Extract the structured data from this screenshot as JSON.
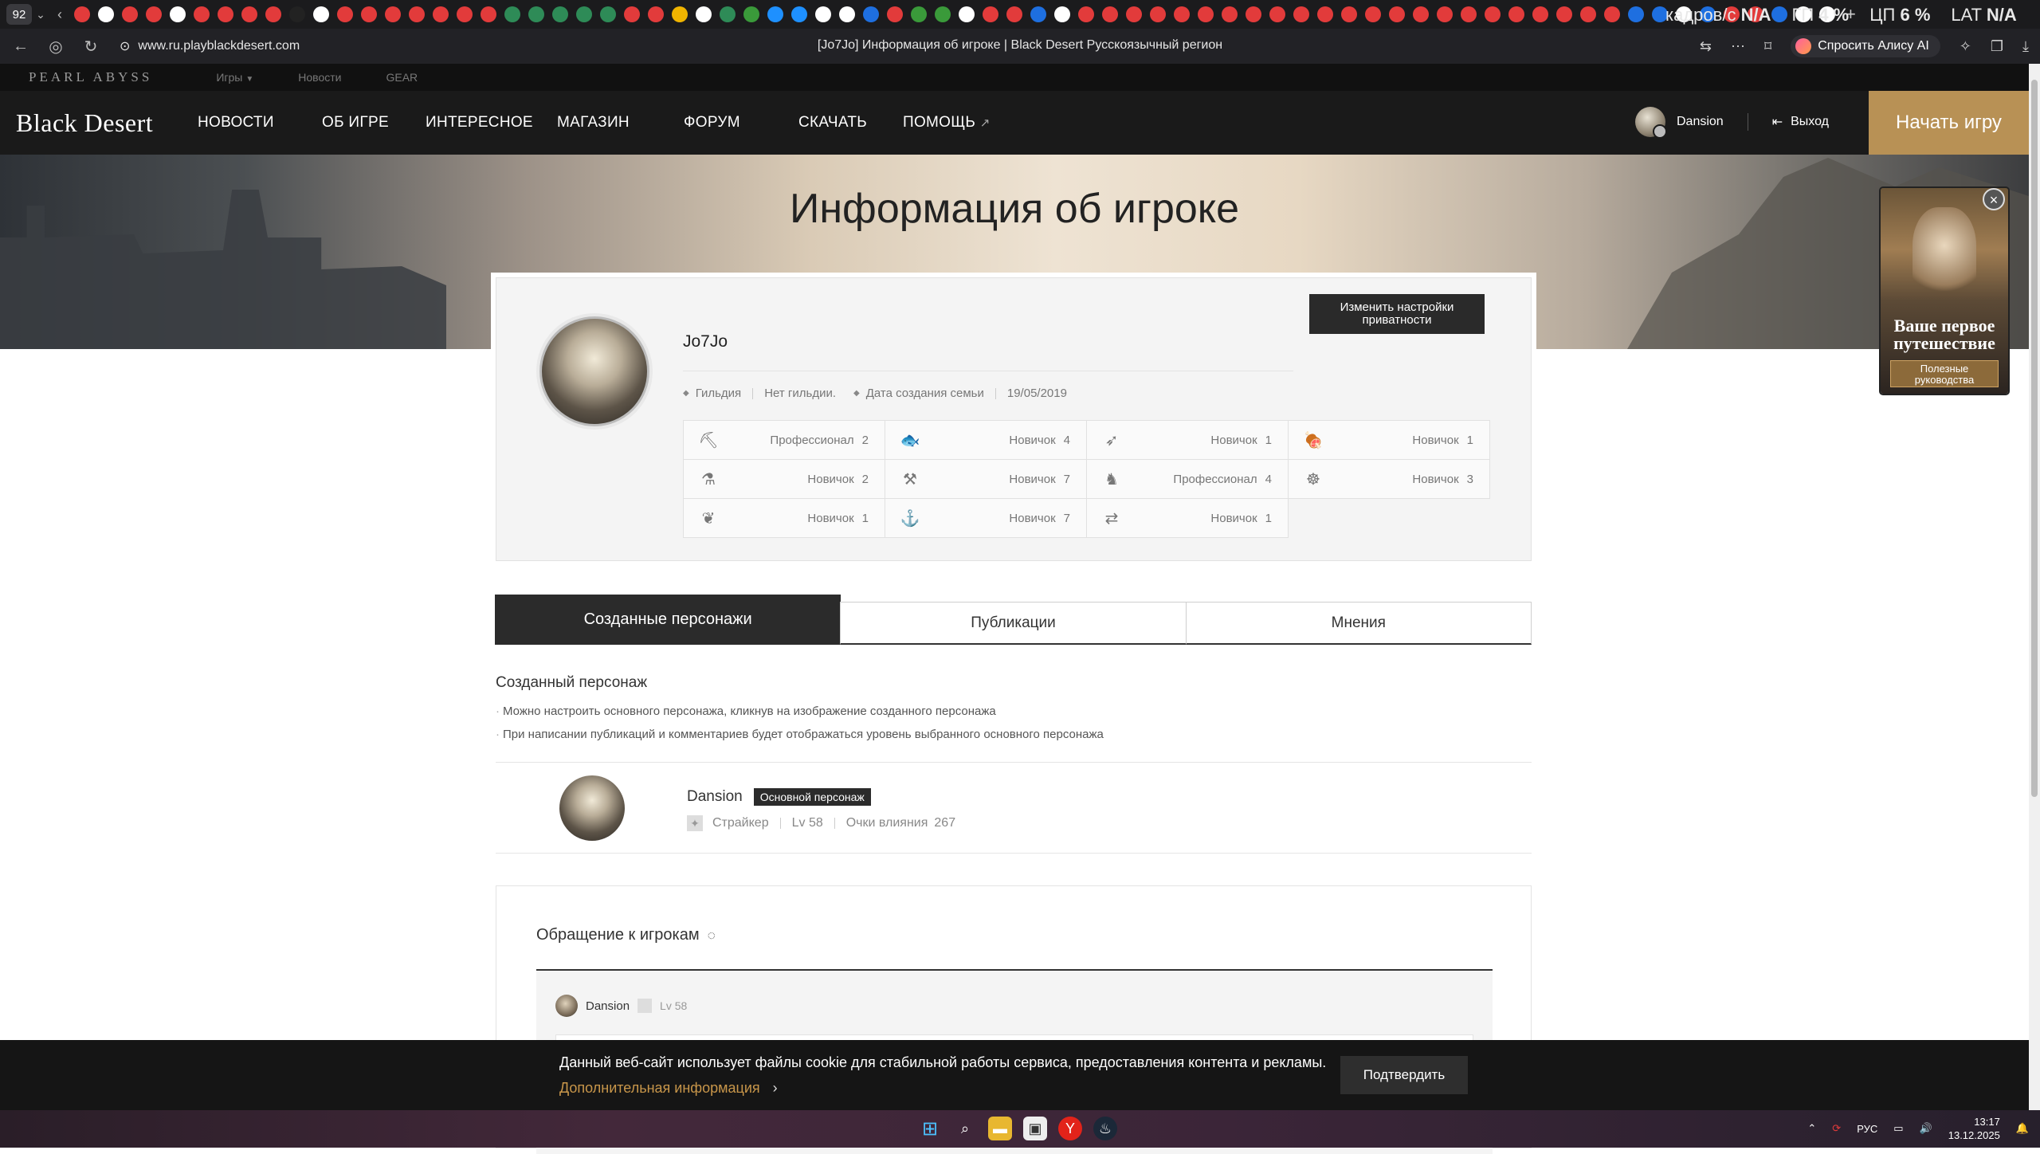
{
  "browser": {
    "tab_count": "92",
    "url": "www.ru.playblackdesert.com",
    "page_title": "[Jo7Jo] Информация об игроке | Black Desert Русскоязычный регион",
    "alice_label": "Спросить Алису AI",
    "overlay": {
      "fps_label": "кадров/с",
      "fps_value": "N/A",
      "gpu_label": "ГП",
      "gpu_value": "4 %",
      "cpu_label": "ЦП",
      "cpu_value": "6 %",
      "lat_label": "LAT",
      "lat_value": "N/A"
    },
    "tab_icon_colors": [
      "#e23b3b",
      "#ffffff",
      "#e23b3b",
      "#e23b3b",
      "#ffffff",
      "#e23b3b",
      "#e23b3b",
      "#e23b3b",
      "#e23b3b",
      "#222222",
      "#ffffff",
      "#e23b3b",
      "#e23b3b",
      "#e23b3b",
      "#e23b3b",
      "#e23b3b",
      "#e23b3b",
      "#e23b3b",
      "#2e8b57",
      "#2e8b57",
      "#2e8b57",
      "#2e8b57",
      "#2e8b57",
      "#e23b3b",
      "#e23b3b",
      "#f0b400",
      "#ffffff",
      "#2e8b57",
      "#3a9a3a",
      "#1e90ff",
      "#1e90ff",
      "#ffffff",
      "#ffffff",
      "#1e6fe0",
      "#e23b3b",
      "#3a9a3a",
      "#3a9a3a",
      "#ffffff",
      "#e23b3b",
      "#e23b3b",
      "#1e6fe0",
      "#ffffff",
      "#e23b3b",
      "#e23b3b",
      "#e23b3b",
      "#e23b3b",
      "#e23b3b",
      "#e23b3b",
      "#e23b3b",
      "#e23b3b",
      "#e23b3b",
      "#e23b3b",
      "#e23b3b",
      "#e23b3b",
      "#e23b3b",
      "#e23b3b",
      "#e23b3b",
      "#e23b3b",
      "#e23b3b",
      "#e23b3b",
      "#e23b3b",
      "#e23b3b",
      "#e23b3b",
      "#e23b3b",
      "#e23b3b",
      "#1e6fe0",
      "#1e6fe0",
      "#ffffff",
      "#1e6fe0",
      "#e23b3b",
      "#e23b3b",
      "#1e6fe0",
      "#ffffff",
      "#ffffff"
    ]
  },
  "site": {
    "pearl_abyss": "PEARL ABYSS",
    "top_links": [
      "Игры",
      "Новости",
      "GEAR"
    ],
    "logo": "Black Desert",
    "nav": [
      "НОВОСТИ",
      "ОБ ИГРЕ",
      "ИНТЕРЕСНОЕ",
      "МАГАЗИН",
      "ФОРУМ",
      "СКАЧАТЬ",
      "ПОМОЩЬ"
    ],
    "user_name": "Dansion",
    "logout": "Выход",
    "start_game": "Начать игру"
  },
  "hero": {
    "title": "Информация об игроке"
  },
  "profile": {
    "name": "Jo7Jo",
    "privacy_button": "Изменить настройки приватности",
    "guild_label": "Гильдия",
    "guild_value": "Нет гильдии.",
    "family_date_label": "Дата создания семьи",
    "family_date_value": "19/05/2019",
    "skills": [
      {
        "icon": "gathering-icon",
        "glyph": "⛏",
        "rank": "Профессионал",
        "level": "2"
      },
      {
        "icon": "fishing-icon",
        "glyph": "🐟",
        "rank": "Новичок",
        "level": "4"
      },
      {
        "icon": "hunting-icon",
        "glyph": "➶",
        "rank": "Новичок",
        "level": "1"
      },
      {
        "icon": "cooking-icon",
        "glyph": "🍖",
        "rank": "Новичок",
        "level": "1"
      },
      {
        "icon": "alchemy-icon",
        "glyph": "⚗",
        "rank": "Новичок",
        "level": "2"
      },
      {
        "icon": "processing-icon",
        "glyph": "⚒",
        "rank": "Новичок",
        "level": "7"
      },
      {
        "icon": "training-icon",
        "glyph": "♞",
        "rank": "Профессионал",
        "level": "4"
      },
      {
        "icon": "trading-icon",
        "glyph": "☸",
        "rank": "Новичок",
        "level": "3"
      },
      {
        "icon": "farming-icon",
        "glyph": "❦",
        "rank": "Новичок",
        "level": "1"
      },
      {
        "icon": "sailing-icon",
        "glyph": "⚓",
        "rank": "Новичок",
        "level": "7"
      },
      {
        "icon": "barter-icon",
        "glyph": "⇄",
        "rank": "Новичок",
        "level": "1"
      }
    ]
  },
  "tabs": [
    "Созданные персонажи",
    "Публикации",
    "Мнения"
  ],
  "characters_section": {
    "title": "Созданный персонаж",
    "notes": [
      "Можно настроить основного персонажа, кликнув на изображение созданного персонажа",
      "При написании публикаций и комментариев будет отображаться уровень выбранного основного персонажа"
    ],
    "character": {
      "name": "Dansion",
      "badge": "Основной персонаж",
      "class": "Страйкер",
      "level": "Lv 58",
      "influence_label": "Очки влияния",
      "influence_value": "267"
    }
  },
  "guestbook": {
    "title": "Обращение к игрокам",
    "user": "Dansion",
    "level": "Lv 58"
  },
  "promo": {
    "text": "Ваше первое путешествие",
    "button": "Полезные руководства"
  },
  "cookie": {
    "text": "Данный веб-сайт использует файлы cookie для стабильной работы сервиса, предоставления контента и рекламы.",
    "link": "Дополнительная информация",
    "button": "Подтвердить"
  },
  "taskbar": {
    "lang": "РУС",
    "time": "13:17",
    "date": "13.12.2025"
  },
  "colors": {
    "gold": "#b89155",
    "dark": "#1a1a1a",
    "cookie_link": "#c8964a"
  }
}
